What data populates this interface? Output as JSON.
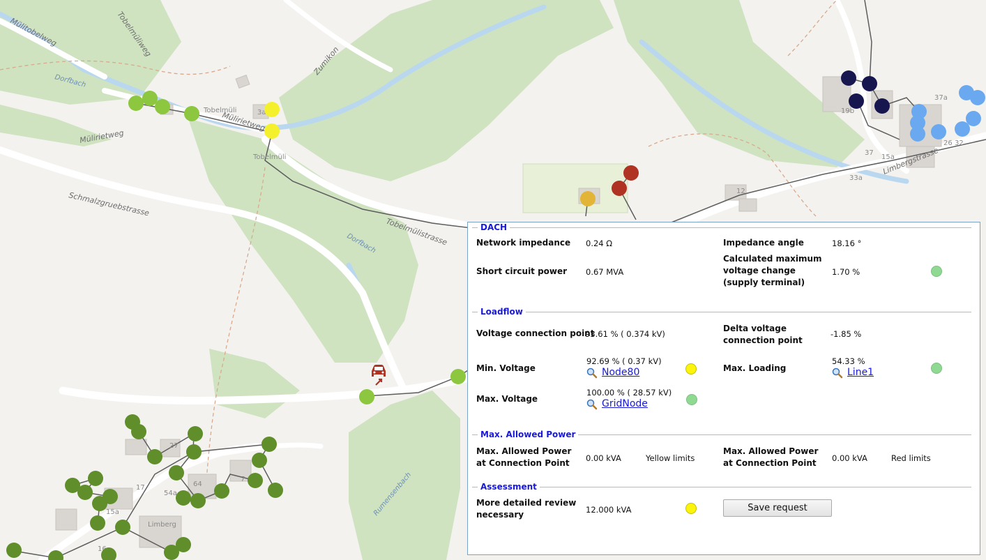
{
  "map": {
    "street_labels": [
      "Mülitobelweg",
      "Tobelmüliweg",
      "Mülirietweg",
      "Mülirietweg",
      "Zumikon",
      "Schmalzgruebstrasse",
      "Tobelmülistrasse",
      "Limbergstrasse"
    ],
    "water_labels": [
      "Dorfbach",
      "Dorfbach",
      "Rumensenbach"
    ],
    "place_labels": [
      "Tobelmüli",
      "Tobelmüli",
      "Limberg"
    ],
    "house_numbers": [
      "3a",
      "27",
      "64",
      "54a",
      "17",
      "15a",
      "12",
      "37",
      "15a",
      "33a",
      "19b",
      "37a",
      "26",
      "32",
      "7",
      "16"
    ],
    "ev_icon": "car-charging-icon",
    "colors": {
      "light_green": "#8dc63f",
      "dark_green": "#5f8e2a",
      "yellow": "#f4f12c",
      "orange": "#e2b437",
      "dark_red": "#b03223",
      "navy": "#17164f",
      "light_blue": "#6aa9ef"
    }
  },
  "panel": {
    "dach": {
      "title": "DACH",
      "network_impedance_label": "Network impedance",
      "network_impedance_value": "0.24 Ω",
      "impedance_angle_label": "Impedance angle",
      "impedance_angle_value": "18.16 °",
      "short_circuit_label": "Short circuit power",
      "short_circuit_value": "0.67 MVA",
      "max_voltage_change_label": "Calculated maximum voltage change (supply terminal)",
      "max_voltage_change_value": "1.70 %"
    },
    "loadflow": {
      "title": "Loadflow",
      "voltage_cp_label": "Voltage connection point",
      "voltage_cp_value": "93.61 % ( 0.374  kV)",
      "delta_voltage_label": "Delta voltage connection point",
      "delta_voltage_value": "-1.85 %",
      "min_voltage_label": "Min. Voltage",
      "min_voltage_value": "92.69 % ( 0.37  kV)",
      "min_voltage_link": "Node80",
      "max_loading_label": "Max. Loading",
      "max_loading_value": "54.33 %",
      "max_loading_link": "Line1",
      "max_voltage_label": "Max. Voltage",
      "max_voltage_value": "100.00 % ( 28.57  kV)",
      "max_voltage_link": "GridNode"
    },
    "max_allowed": {
      "title": "Max. Allowed Power",
      "yellow_label": "Max. Allowed Power at Connection Point",
      "yellow_value": "0.00 kVA",
      "yellow_note": "Yellow limits",
      "red_label": "Max. Allowed Power at Connection Point",
      "red_value": "0.00 kVA",
      "red_note": "Red limits"
    },
    "assessment": {
      "title": "Assessment",
      "review_label": "More detailed review necessary",
      "review_value": "12.000 kVA",
      "save_label": "Save request"
    }
  }
}
